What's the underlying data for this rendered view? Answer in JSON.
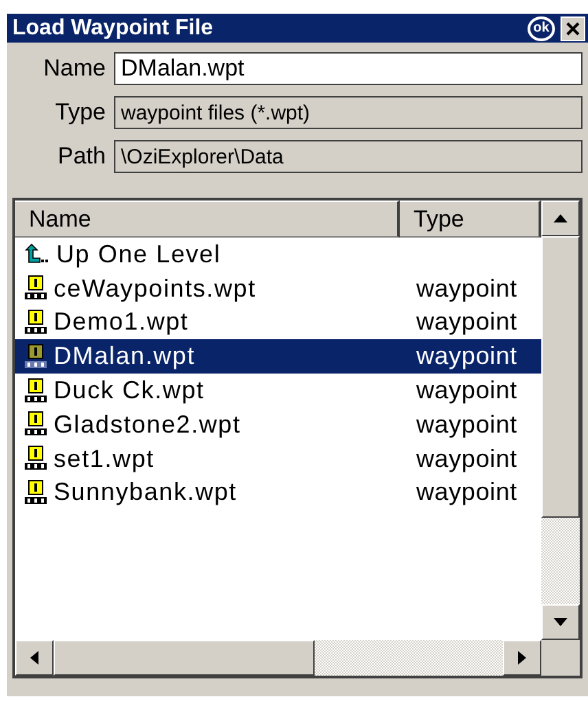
{
  "window": {
    "title": "Load Waypoint File",
    "ok_button": "ok"
  },
  "fields": [
    {
      "label": "Name",
      "value": "DMalan.wpt",
      "disabled": false
    },
    {
      "label": "Type",
      "value": "waypoint files (*.wpt)",
      "disabled": true
    },
    {
      "label": "Path",
      "value": "\\OziExplorer\\Data",
      "disabled": true
    }
  ],
  "file_list": {
    "columns": [
      "Name",
      "Type"
    ],
    "rows": [
      {
        "kind": "parent",
        "name": "Up One Level",
        "selected": false
      },
      {
        "kind": "file",
        "name": "ceWaypoints.wpt",
        "type": "waypoint",
        "selected": false
      },
      {
        "kind": "file",
        "name": "Demo1.wpt",
        "type": "waypoint",
        "selected": false
      },
      {
        "kind": "file",
        "name": "DMalan.wpt",
        "type": "waypoint",
        "selected": true
      },
      {
        "kind": "file",
        "name": "Duck Ck.wpt",
        "type": "waypoint",
        "selected": false
      },
      {
        "kind": "file",
        "name": "Gladstone2.wpt",
        "type": "waypoint",
        "selected": false
      },
      {
        "kind": "file",
        "name": "set1.wpt",
        "type": "waypoint",
        "selected": false
      },
      {
        "kind": "file",
        "name": "Sunnybank.wpt",
        "type": "waypoint",
        "selected": false
      }
    ]
  }
}
